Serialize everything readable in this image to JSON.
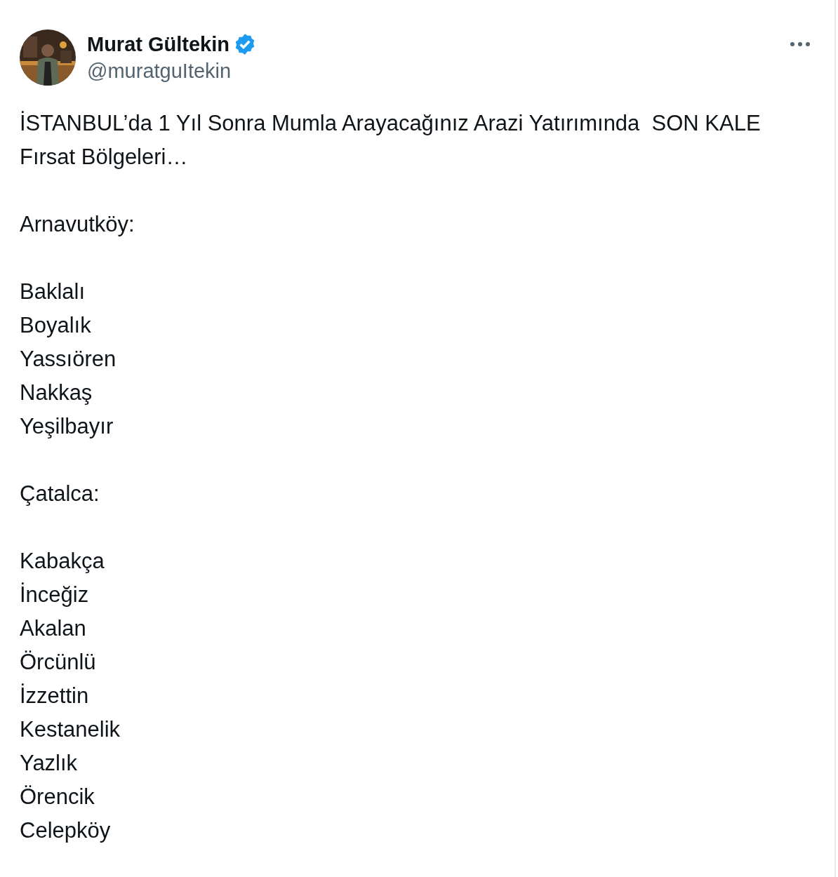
{
  "author": {
    "name": "Murat Gültekin",
    "verified": true,
    "handle": "@muratguItekin"
  },
  "blocks": [
    {
      "lines": [
        "İSTANBUL’da 1 Yıl Sonra Mumla Arayacağınız Arazi Yatırımında  SON KALE Fırsat Bölgeleri…"
      ]
    },
    {
      "lines": [
        "Arnavutköy:"
      ]
    },
    {
      "lines": [
        "Baklalı",
        "Boyalık",
        "Yassıören",
        "Nakkaş",
        "Yeşilbayır"
      ]
    },
    {
      "lines": [
        "Çatalca:"
      ]
    },
    {
      "lines": [
        "Kabakça",
        "İnceğiz",
        "Akalan",
        "Örcünlü",
        "İzzettin",
        "Kestanelik",
        "Yazlık",
        "Örencik",
        "Celepköy"
      ]
    }
  ]
}
